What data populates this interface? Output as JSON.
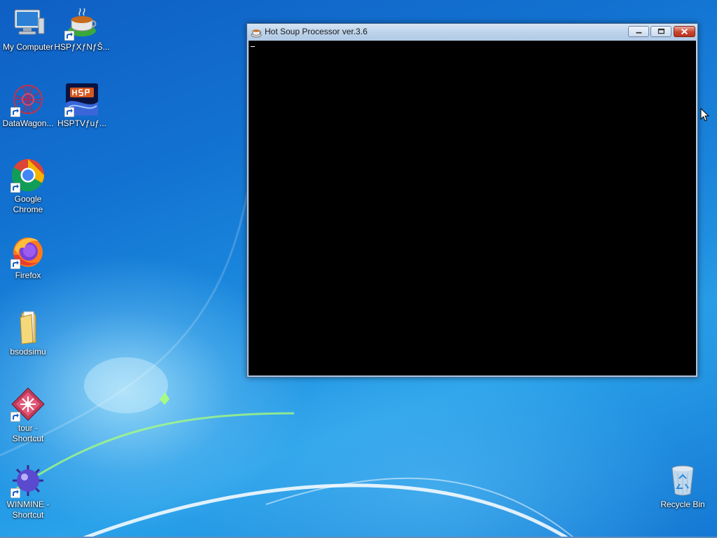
{
  "desktop": {
    "icons": [
      {
        "label": "My Computer",
        "icon": "computer-icon",
        "shortcut": false
      },
      {
        "label": "HSPƒXƒNƒŠ...",
        "icon": "hsp-teacup-icon",
        "shortcut": true
      },
      {
        "label": "DataWagon...",
        "icon": "datawagon-icon",
        "shortcut": true
      },
      {
        "label": "HSPTVƒuƒ...",
        "icon": "hsptv-icon",
        "shortcut": true
      },
      {
        "label": "Google\nChrome",
        "icon": "chrome-icon",
        "shortcut": true
      },
      {
        "label": "Firefox",
        "icon": "firefox-icon",
        "shortcut": true
      },
      {
        "label": "bsodsimu",
        "icon": "folder-icon",
        "shortcut": false
      },
      {
        "label": "tour -\nShortcut",
        "icon": "tour-icon",
        "shortcut": true
      },
      {
        "label": "WINMINE -\nShortcut",
        "icon": "mine-icon",
        "shortcut": true
      },
      {
        "label": "Recycle Bin",
        "icon": "recycle-bin-icon",
        "shortcut": false
      }
    ]
  },
  "window": {
    "title": "Hot Soup Processor ver.3.6",
    "title_icon": "hsp-teacup-icon",
    "buttons": {
      "minimize": "minimize-icon",
      "maximize": "maximize-icon",
      "close": "close-icon"
    },
    "client_background": "#000000"
  },
  "colors": {
    "wallpaper": "#1a7fd8",
    "window_frame": "#b5cde9",
    "close_button": "#c9452f"
  }
}
